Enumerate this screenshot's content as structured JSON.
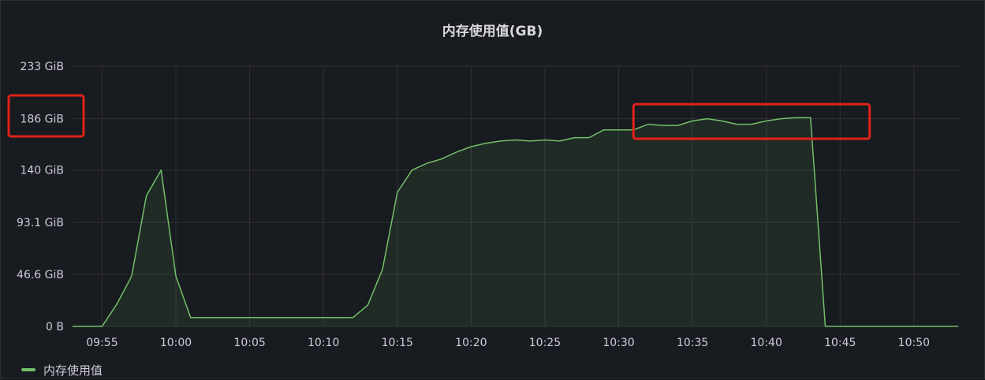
{
  "panel": {
    "title": "内存使用值(GB)"
  },
  "chart_data": {
    "type": "area",
    "title": "内存使用值(GB)",
    "xlabel": "",
    "ylabel": "",
    "y_unit": "GiB",
    "ylim": [
      0,
      233
    ],
    "y_ticks": [
      {
        "value": 0,
        "label": "0 B"
      },
      {
        "value": 46.6,
        "label": "46.6 GiB"
      },
      {
        "value": 93.1,
        "label": "93.1 GiB"
      },
      {
        "value": 140,
        "label": "140 GiB"
      },
      {
        "value": 186,
        "label": "186 GiB"
      },
      {
        "value": 233,
        "label": "233 GiB"
      }
    ],
    "x_ticks": [
      "09:55",
      "10:00",
      "10:05",
      "10:10",
      "10:15",
      "10:20",
      "10:25",
      "10:30",
      "10:35",
      "10:40",
      "10:45",
      "10:50"
    ],
    "xlim": [
      "09:53",
      "10:53"
    ],
    "grid": true,
    "legend_position": "bottom-left",
    "series": [
      {
        "name": "内存使用值",
        "color": "#73bf69",
        "points": [
          [
            "09:53",
            0
          ],
          [
            "09:54",
            0
          ],
          [
            "09:55",
            0
          ],
          [
            "09:56",
            20
          ],
          [
            "09:57",
            45
          ],
          [
            "09:58",
            117
          ],
          [
            "09:59",
            140
          ],
          [
            "10:00",
            45
          ],
          [
            "10:01",
            8
          ],
          [
            "10:02",
            8
          ],
          [
            "10:03",
            8
          ],
          [
            "10:04",
            8
          ],
          [
            "10:05",
            8
          ],
          [
            "10:06",
            8
          ],
          [
            "10:07",
            8
          ],
          [
            "10:08",
            8
          ],
          [
            "10:09",
            8
          ],
          [
            "10:10",
            8
          ],
          [
            "10:11",
            8
          ],
          [
            "10:12",
            8
          ],
          [
            "10:13",
            19
          ],
          [
            "10:14",
            51
          ],
          [
            "10:15",
            120
          ],
          [
            "10:16",
            140
          ],
          [
            "10:17",
            146
          ],
          [
            "10:18",
            150
          ],
          [
            "10:19",
            156
          ],
          [
            "10:20",
            161
          ],
          [
            "10:21",
            164
          ],
          [
            "10:22",
            166
          ],
          [
            "10:23",
            167
          ],
          [
            "10:24",
            166
          ],
          [
            "10:25",
            167
          ],
          [
            "10:26",
            166
          ],
          [
            "10:27",
            169
          ],
          [
            "10:28",
            169
          ],
          [
            "10:29",
            176
          ],
          [
            "10:30",
            176
          ],
          [
            "10:31",
            176
          ],
          [
            "10:32",
            181
          ],
          [
            "10:33",
            180
          ],
          [
            "10:34",
            180
          ],
          [
            "10:35",
            184
          ],
          [
            "10:36",
            186
          ],
          [
            "10:37",
            184
          ],
          [
            "10:38",
            181
          ],
          [
            "10:39",
            181
          ],
          [
            "10:40",
            184
          ],
          [
            "10:41",
            186
          ],
          [
            "10:42",
            187
          ],
          [
            "10:43",
            187
          ],
          [
            "10:44",
            0
          ],
          [
            "10:45",
            0
          ],
          [
            "10:46",
            0
          ],
          [
            "10:47",
            0
          ],
          [
            "10:48",
            0
          ],
          [
            "10:49",
            0
          ],
          [
            "10:50",
            0
          ],
          [
            "10:51",
            0
          ],
          [
            "10:52",
            0
          ],
          [
            "10:53",
            0
          ]
        ]
      }
    ],
    "annotations": [
      {
        "type": "highlight-box",
        "color": "#e0221a",
        "target": "y-tick",
        "label": "186 GiB"
      },
      {
        "type": "highlight-box",
        "color": "#e0221a",
        "target": "plateau",
        "x_range": [
          "10:31",
          "10:47"
        ],
        "y_range": [
          168,
          199
        ]
      }
    ]
  }
}
